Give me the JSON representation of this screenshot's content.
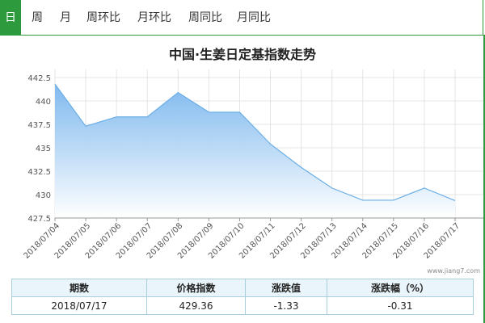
{
  "tabs": [
    {
      "label": "日",
      "active": true
    },
    {
      "label": "周",
      "active": false
    },
    {
      "label": "月",
      "active": false
    },
    {
      "label": "周环比",
      "active": false
    },
    {
      "label": "月环比",
      "active": false
    },
    {
      "label": "周同比",
      "active": false
    },
    {
      "label": "月同比",
      "active": false
    }
  ],
  "colors": {
    "accent": "#2e9a3e",
    "line": "#6aaee6",
    "fill_top": "#7ab6ee",
    "fill_bottom": "#ffffff",
    "grid": "#e4e4e4"
  },
  "chart_data": {
    "type": "area",
    "title": "中国·生姜日定基指数走势",
    "xlabel": "",
    "ylabel": "",
    "x": [
      "2018/07/04",
      "2018/07/05",
      "2018/07/06",
      "2018/07/07",
      "2018/07/08",
      "2018/07/09",
      "2018/07/10",
      "2018/07/11",
      "2018/07/12",
      "2018/07/13",
      "2018/07/14",
      "2018/07/15",
      "2018/07/16",
      "2018/07/17"
    ],
    "series": [
      {
        "values": [
          441.8,
          437.3,
          438.3,
          438.3,
          440.9,
          438.8,
          438.8,
          435.4,
          432.9,
          430.7,
          429.4,
          429.4,
          430.7,
          429.36
        ]
      }
    ],
    "yticks": [
      "442.5",
      "440",
      "437.5",
      "435",
      "432.5",
      "430",
      "427.5"
    ],
    "ylim": [
      427.5,
      442.5
    ],
    "grid": true,
    "legend": "none"
  },
  "watermark": "www.jiang7.com",
  "table": {
    "headers": [
      "期数",
      "价格指数",
      "涨跌值",
      "涨跌幅（%）"
    ],
    "rows": [
      [
        "2018/07/17",
        "429.36",
        "-1.33",
        "-0.31"
      ]
    ]
  }
}
